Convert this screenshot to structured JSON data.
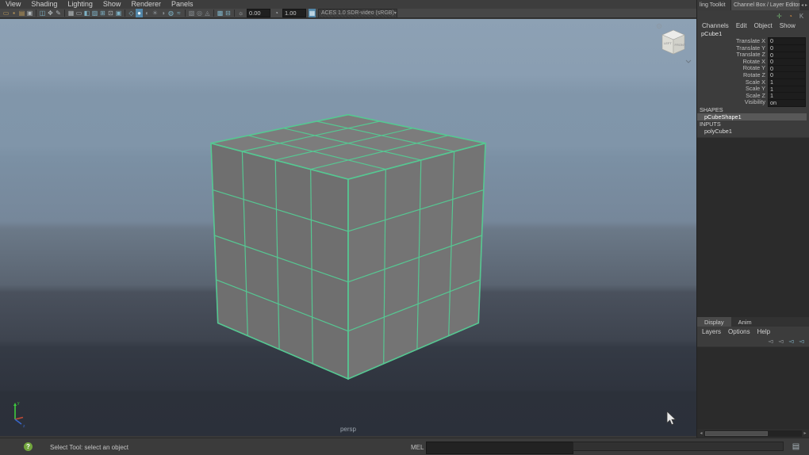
{
  "colors": {
    "accent_blue": "#5286a8",
    "wire_green": "#56c792",
    "cube_face_top": "#7c7c7c",
    "cube_face_left": "#6f6f6f",
    "cube_face_right": "#747474",
    "viewport_top": "#8da1b4",
    "viewport_bottom": "#2b303a",
    "help_green": "#72a53d"
  },
  "panel_menu": {
    "items": [
      "View",
      "Shading",
      "Lighting",
      "Show",
      "Renderer",
      "Panels"
    ]
  },
  "toolbar": {
    "exposure_value": "0.00",
    "gamma_value": "1.00",
    "colorspace": "ACES 1.0 SDR-video (sRGB)",
    "dropdown_arrow": "▾",
    "icons": [
      {
        "name": "select-camera-icon",
        "glyph": "▭",
        "color": "#bd9a5a"
      },
      {
        "name": "lock-camera-icon",
        "glyph": "▪",
        "color": "#bd9a5a"
      },
      {
        "name": "camera-attributes-icon",
        "glyph": "▤",
        "color": "#bd9a5a"
      },
      {
        "name": "bookmarks-icon",
        "glyph": "▣",
        "color": "#b3b9bc"
      },
      "|",
      {
        "name": "image-plane-icon",
        "glyph": "◫",
        "color": "#7fb3c7"
      },
      {
        "name": "2d-pan-zoom-icon",
        "glyph": "✥",
        "color": "#b3b9bc"
      },
      {
        "name": "grease-pencil-icon",
        "glyph": "✎",
        "color": "#b3b9bc"
      },
      "|",
      {
        "name": "grid-icon",
        "glyph": "▦",
        "color": "#b3b9bc"
      },
      {
        "name": "film-gate-icon",
        "glyph": "▭",
        "color": "#b3b9bc"
      },
      {
        "name": "resolution-gate-icon",
        "glyph": "◧",
        "color": "#7fb3c7"
      },
      {
        "name": "gate-mask-icon",
        "glyph": "▨",
        "color": "#7fb3c7"
      },
      {
        "name": "field-chart-icon",
        "glyph": "⊞",
        "color": "#7fb3c7"
      },
      {
        "name": "safe-action-icon",
        "glyph": "⊡",
        "color": "#b3b9bc"
      },
      {
        "name": "safe-title-icon",
        "glyph": "▣",
        "color": "#7fb3c7"
      },
      "|",
      {
        "name": "wireframe-icon",
        "glyph": "◇",
        "color": "#7fb3c7"
      },
      {
        "name": "shaded-icon",
        "glyph": "●",
        "color": "#eaf4fa",
        "active": true
      },
      {
        "name": "textured-icon",
        "glyph": "◐",
        "color": "#8a9094"
      },
      {
        "name": "use-all-lights-icon",
        "glyph": "☀",
        "color": "#8a9094"
      },
      {
        "name": "shadows-icon",
        "glyph": "◑",
        "color": "#8a9094"
      },
      {
        "name": "screen-space-ao-icon",
        "glyph": "◍",
        "color": "#7fb3c7"
      },
      {
        "name": "motion-blur-icon",
        "glyph": "≈",
        "color": "#7fb3c7"
      },
      "|",
      {
        "name": "multisample-aa-icon",
        "glyph": "▧",
        "color": "#8a9094"
      },
      {
        "name": "depth-of-field-icon",
        "glyph": "◎",
        "color": "#8a9094"
      },
      {
        "name": "isolate-select-icon",
        "glyph": "◬",
        "color": "#8a9094"
      },
      "|",
      {
        "name": "xray-icon",
        "glyph": "▩",
        "color": "#7fb3c7"
      },
      {
        "name": "xray-joints-icon",
        "glyph": "⊟",
        "color": "#7fb3c7"
      },
      "|",
      {
        "name": "exposure-icon",
        "glyph": "☼",
        "color": "#b3b9bc"
      }
    ],
    "gamma_icon_glyph": "◔",
    "colorspace_toggle_glyph": "▦"
  },
  "viewport": {
    "camera_label": "persp",
    "cube": {
      "object_name": "pCube1",
      "divisions": 4,
      "wire_color": "#56c792",
      "face_top": "#7c7c7c",
      "face_left": "#6f6f6f",
      "face_right": "#747474"
    },
    "viewcube": {
      "left_label": "LEFT",
      "front_label": "FRONT"
    },
    "axis": {
      "x": "x",
      "y": "y",
      "z": "z"
    }
  },
  "channel_box": {
    "tab_left": "ling Toolkit",
    "tab_right": "Channel Box / Layer Editor",
    "tab_arrow_left": "◂",
    "tab_arrow_right": "▸",
    "corner_icons": [
      {
        "name": "pin-channel-icon",
        "glyph": "✛",
        "color": "#6fae6f"
      },
      {
        "name": "slider-speed-icon",
        "glyph": "◔",
        "color": "#cf8b42"
      },
      {
        "name": "hyperbolic-slider-icon",
        "glyph": "K",
        "color": "#9aa0a4"
      }
    ],
    "menu": [
      "Channels",
      "Edit",
      "Object",
      "Show"
    ],
    "object_name": "pCube1",
    "attributes": [
      {
        "label": "Translate X",
        "value": "0"
      },
      {
        "label": "Translate Y",
        "value": "0"
      },
      {
        "label": "Translate Z",
        "value": "0"
      },
      {
        "label": "Rotate X",
        "value": "0"
      },
      {
        "label": "Rotate Y",
        "value": "0"
      },
      {
        "label": "Rotate Z",
        "value": "0"
      },
      {
        "label": "Scale X",
        "value": "1"
      },
      {
        "label": "Scale Y",
        "value": "1"
      },
      {
        "label": "Scale Z",
        "value": "1"
      },
      {
        "label": "Visibility",
        "value": "on"
      }
    ],
    "shapes_header": "SHAPES",
    "shape_node": "pCubeShape1",
    "inputs_header": "INPUTS",
    "input_node": "polyCube1"
  },
  "layer_editor": {
    "tabs": [
      "Display",
      "Anim"
    ],
    "menu": [
      "Layers",
      "Options",
      "Help"
    ],
    "icons": [
      {
        "name": "hide-layers-icon",
        "glyph": "◅",
        "color": "#9aa0a4"
      },
      {
        "name": "show-layers-icon",
        "glyph": "◅",
        "color": "#9aa0a4"
      },
      {
        "name": "create-layer-from-selected-icon",
        "glyph": "◅",
        "color": "#7fb3c7"
      },
      {
        "name": "create-empty-layer-icon",
        "glyph": "◅",
        "color": "#7fb3c7"
      }
    ],
    "scroll_left_arrow": "◂",
    "scroll_right_arrow": "▸"
  },
  "status_bar": {
    "help_glyph": "?",
    "help_text": "Select Tool: select an object",
    "mel_label": "MEL",
    "script_editor_glyph": "▤"
  }
}
